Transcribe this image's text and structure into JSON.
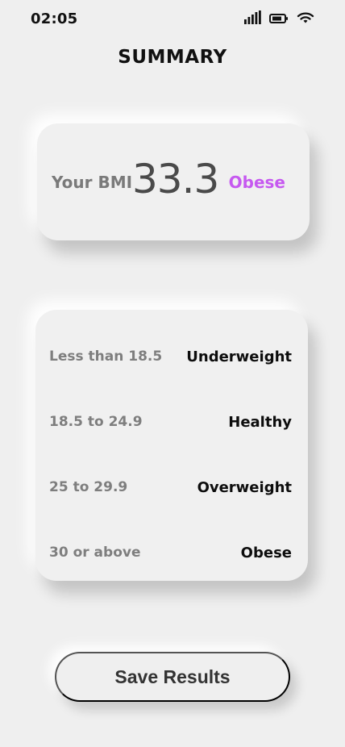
{
  "status_bar": {
    "time": "02:05",
    "icons": [
      "signal-icon",
      "battery-icon",
      "wifi-icon"
    ]
  },
  "header": {
    "title": "SUMMARY"
  },
  "bmi_result": {
    "label": "Your BMI",
    "value": "33.3",
    "category": "Obese",
    "category_color": "#c659f0"
  },
  "ranges": [
    {
      "range": "Less than 18.5",
      "label": "Underweight"
    },
    {
      "range": "18.5 to 24.9",
      "label": "Healthy"
    },
    {
      "range": "25 to 29.9",
      "label": "Overweight"
    },
    {
      "range": "30 or above",
      "label": "Obese"
    }
  ],
  "actions": {
    "save_label": "Save Results"
  },
  "colors": {
    "background": "#efefef",
    "text_primary": "#111111",
    "text_secondary": "#7e7e7e"
  }
}
